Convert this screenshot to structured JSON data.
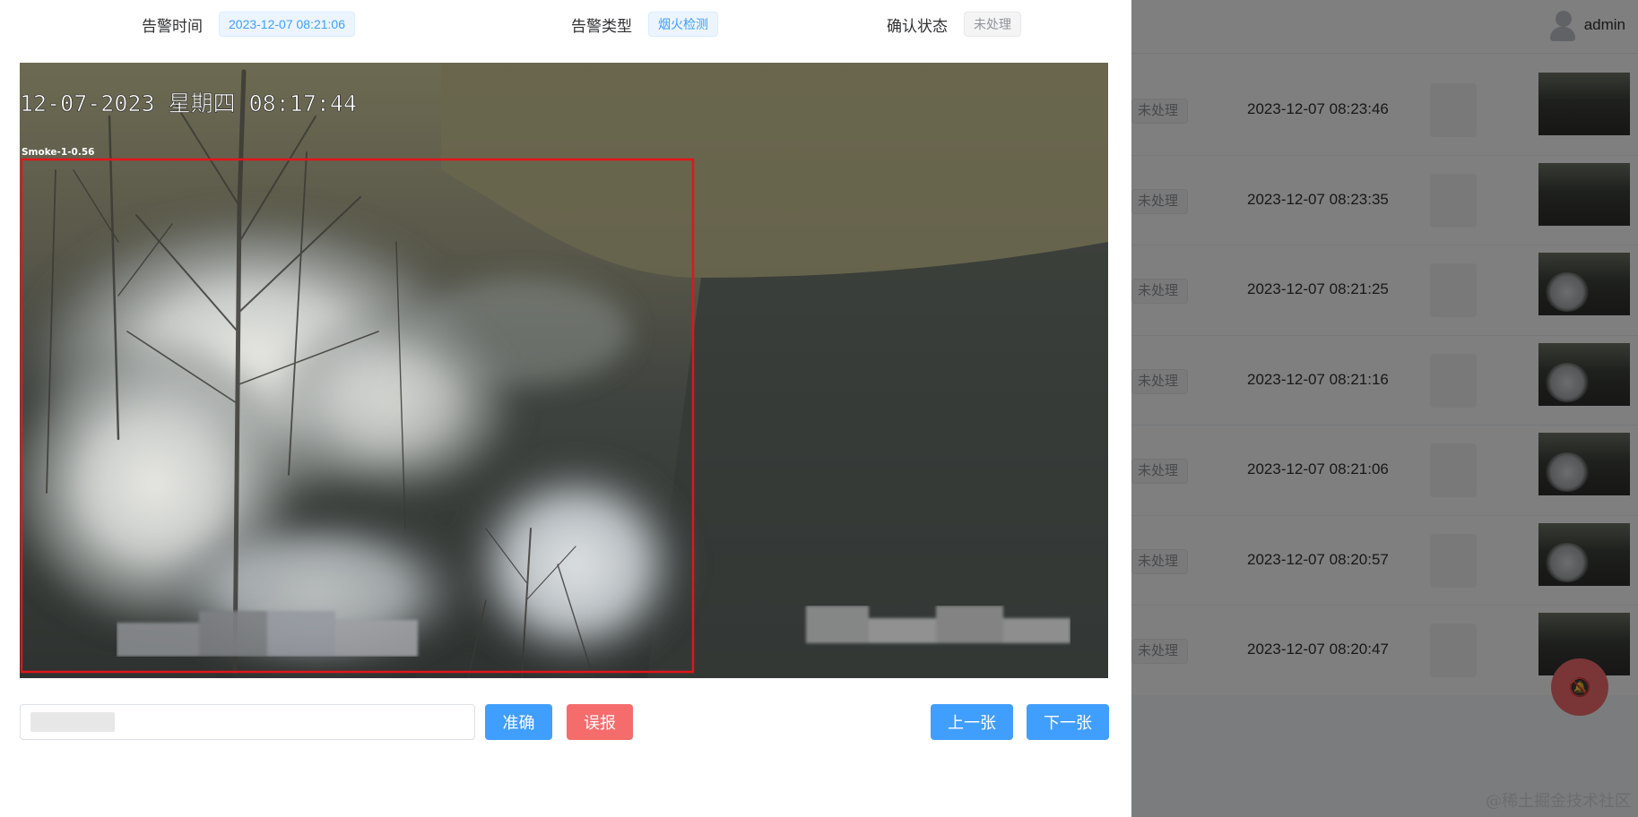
{
  "background": {
    "user": {
      "name": "admin"
    },
    "rows": [
      {
        "status": "未处理",
        "time": "2023-12-07 08:23:46"
      },
      {
        "status": "未处理",
        "time": "2023-12-07 08:23:35"
      },
      {
        "status": "未处理",
        "time": "2023-12-07 08:21:25"
      },
      {
        "status": "未处理",
        "time": "2023-12-07 08:21:16"
      },
      {
        "status": "未处理",
        "time": "2023-12-07 08:21:06"
      },
      {
        "status": "未处理",
        "time": "2023-12-07 08:20:57"
      },
      {
        "status": "未处理",
        "time": "2023-12-07 08:20:47"
      }
    ],
    "watermark": "@稀土掘金技术社区"
  },
  "detail": {
    "alarm_time_label": "告警时间",
    "alarm_time_value": "2023-12-07 08:21:06",
    "alarm_type_label": "告警类型",
    "alarm_type_value": "烟火检测",
    "confirm_status_label": "确认状态",
    "confirm_status_value": "未处理",
    "image": {
      "timestamp": "12-07-2023 星期四 08:17:44",
      "detection_label": "Smoke-1-0.56"
    },
    "comment": {
      "value": "",
      "placeholder": ""
    },
    "buttons": {
      "accurate": "准确",
      "false_alarm": "误报",
      "prev": "上一张",
      "next": "下一张"
    }
  },
  "colors": {
    "primary": "#409eff",
    "danger": "#f56c6c",
    "detection_box": "#e0161b"
  }
}
